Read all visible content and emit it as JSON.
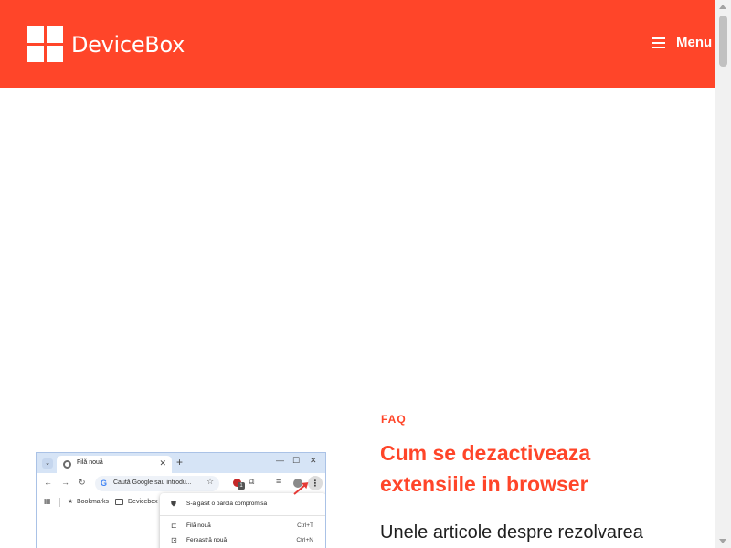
{
  "header": {
    "logo_text": "DeviceBox",
    "menu_label": "Menu",
    "background_color": "#ff4529"
  },
  "article": {
    "category": "FAQ",
    "title": "Cum se dezactiveaza extensiile in browser",
    "excerpt": "Unele articole despre rezolvarea",
    "accent_color": "#ff4529"
  },
  "thumbnail": {
    "tab_title": "Filă nouă",
    "omnibox_placeholder": "Caută Google sau introdu...",
    "extension_badge_count": "1",
    "bookmarks": [
      "Bookmarks",
      "Devicebox"
    ],
    "menu_items": [
      {
        "label": "S-a găsit o parolă compromisă",
        "shortcut": ""
      },
      {
        "label": "Filă nouă",
        "shortcut": "Ctrl+T"
      },
      {
        "label": "Fereastră nouă",
        "shortcut": "Ctrl+N"
      }
    ],
    "icons": {
      "tab_dropdown": "chevron-down-icon",
      "tab_close": "close-icon",
      "new_tab": "plus-icon",
      "back": "arrow-left-icon",
      "forward": "arrow-right-icon",
      "reload": "reload-icon",
      "bookmark_star": "star-icon",
      "extensions": "puzzle-icon",
      "menu": "kebab-icon"
    }
  }
}
